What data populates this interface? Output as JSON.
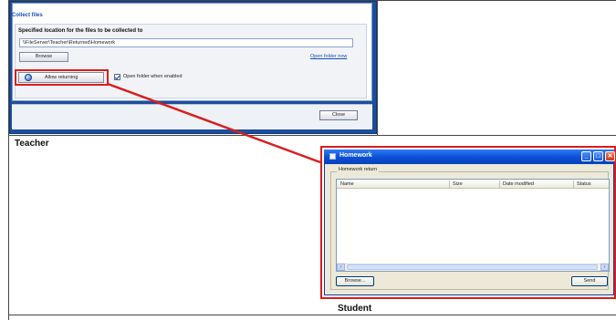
{
  "teacher": {
    "section_title": "Collect files",
    "location_label": "Specified location for the files to be collected to",
    "path_value": "\\\\FileServer\\Teacher\\Returned\\Homework",
    "browse_label": "Browse",
    "open_folder_now": "Open folder now",
    "allow_returning_label": "Allow returning",
    "open_when_enabled_label": "Open folder when enabled",
    "open_when_enabled_checked": true,
    "close_label": "Close",
    "caption": "Teacher"
  },
  "student": {
    "window_title": "Homework",
    "group_label": "Homework return",
    "columns": [
      "Name",
      "Size",
      "Date modified",
      "Status"
    ],
    "browse_label": "Browse...",
    "send_label": "Send",
    "caption": "Student"
  },
  "colors": {
    "highlight": "#d81e1e",
    "dialog_blue": "#1c4e9e",
    "xp_titlebar": "#0a4fd6"
  },
  "icons": {
    "allow": "allow-returning-icon",
    "window": "window-icon",
    "minimize": "minimize-icon",
    "maximize": "maximize-icon",
    "close": "close-icon"
  }
}
